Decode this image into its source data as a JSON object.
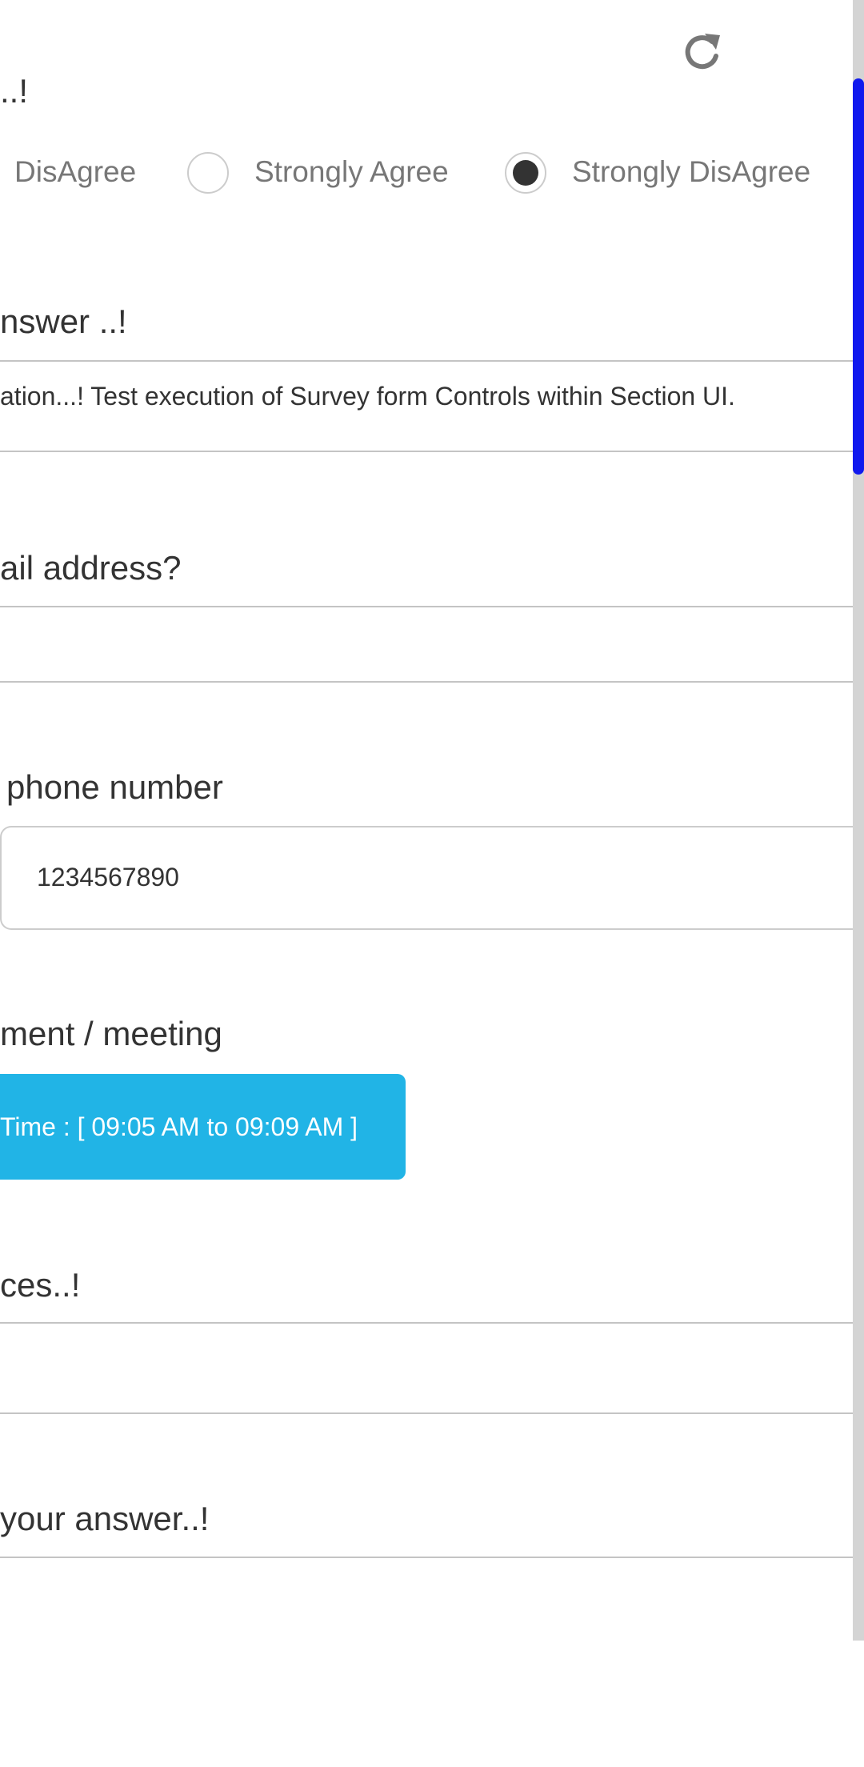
{
  "top_bar": {
    "refresh_icon": "refresh-icon"
  },
  "q1": {
    "title": "..!",
    "options": [
      {
        "label": "DisAgree",
        "selected": false
      },
      {
        "label": "Strongly Agree",
        "selected": false
      },
      {
        "label": "Strongly DisAgree",
        "selected": true
      }
    ]
  },
  "q2": {
    "title": "nswer ..!",
    "answer": "ation...! Test execution of Survey form Controls within Section UI."
  },
  "q3": {
    "title": "ail address?",
    "answer": ""
  },
  "q4": {
    "title": " phone number",
    "value": "1234567890"
  },
  "q5": {
    "title": "ment / meeting",
    "button_label": "Time : [ 09:05 AM to 09:09 AM ]"
  },
  "q6": {
    "title": "ces..!",
    "answer": ""
  },
  "q7": {
    "title": "your answer..!"
  },
  "colors": {
    "accent": "#21b4e6",
    "scrollbar_thumb": "#1019ee",
    "text": "#333333"
  }
}
